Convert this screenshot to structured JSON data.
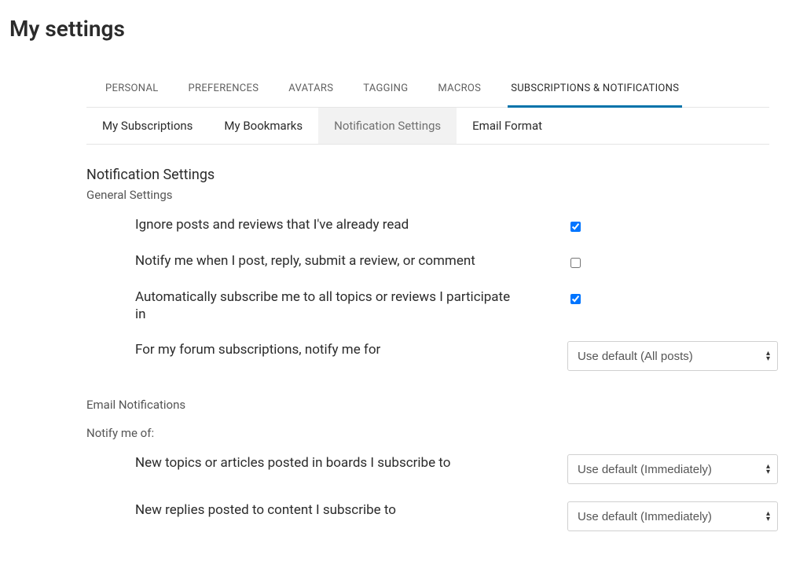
{
  "page_title": "My settings",
  "primary_tabs": {
    "personal": "PERSONAL",
    "preferences": "PREFERENCES",
    "avatars": "AVATARS",
    "tagging": "TAGGING",
    "macros": "MACROS",
    "subscriptions": "SUBSCRIPTIONS & NOTIFICATIONS"
  },
  "secondary_tabs": {
    "my_subscriptions": "My Subscriptions",
    "my_bookmarks": "My Bookmarks",
    "notification_settings": "Notification Settings",
    "email_format": "Email Format"
  },
  "sections": {
    "notification_settings_heading": "Notification Settings",
    "general_settings_sub": "General Settings",
    "email_notifications_sub": "Email Notifications",
    "notify_me_of_sub": "Notify me of:"
  },
  "settings": {
    "ignore_read": {
      "label": "Ignore posts and reviews that I've already read",
      "checked": true
    },
    "notify_post": {
      "label": "Notify me when I post, reply, submit a review, or comment",
      "checked": false
    },
    "auto_subscribe": {
      "label": "Automatically subscribe me to all topics or reviews I participate in",
      "checked": true
    },
    "forum_subscriptions": {
      "label": "For my forum subscriptions, notify me for",
      "selected": "Use default (All posts)"
    },
    "new_topics": {
      "label": "New topics or articles posted in boards I subscribe to",
      "selected": "Use default (Immediately)"
    },
    "new_replies": {
      "label": "New replies posted to content I subscribe to",
      "selected": "Use default (Immediately)"
    }
  }
}
